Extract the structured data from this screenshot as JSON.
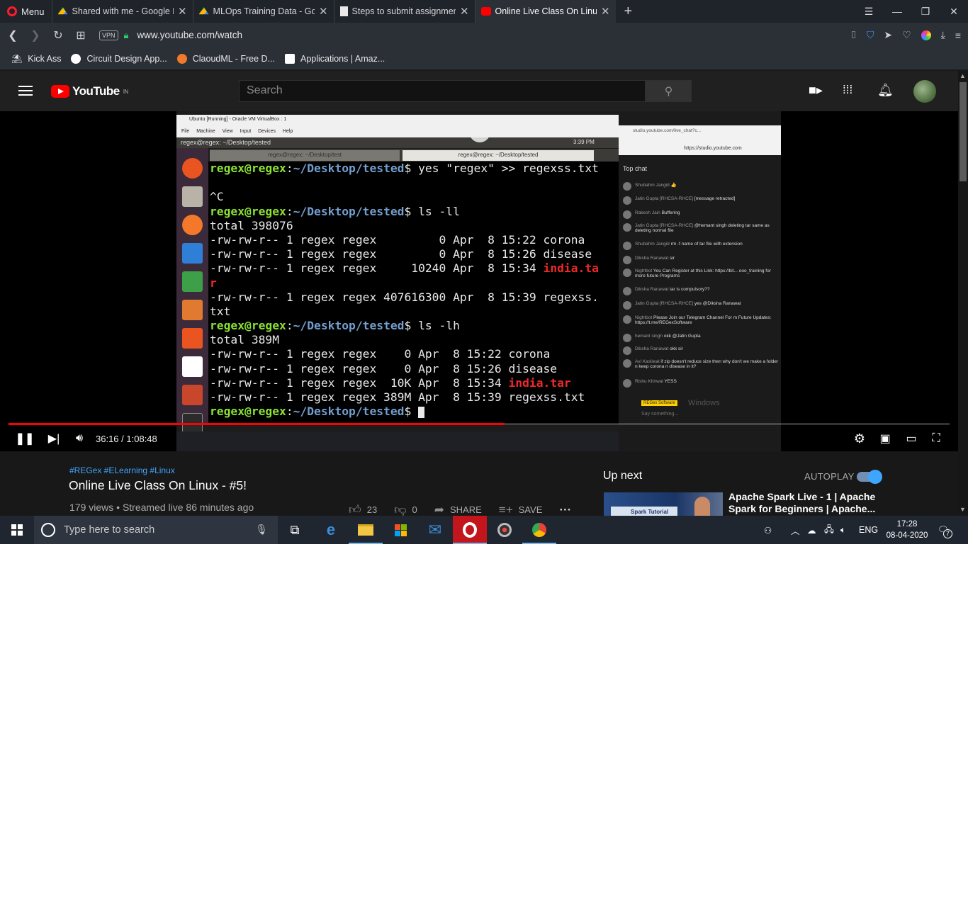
{
  "browser": {
    "menu_label": "Menu",
    "tabs": [
      {
        "title": "Shared with me - Google D",
        "favicon": "drive-icon",
        "active": false
      },
      {
        "title": "MLOps Training Data - Goo",
        "favicon": "drive-icon",
        "active": false
      },
      {
        "title": "Steps to submit assignmen",
        "favicon": "document-icon",
        "active": false
      },
      {
        "title": "Online Live Class On Linux",
        "favicon": "youtube-icon",
        "active": true
      }
    ],
    "url": "www.youtube.com/watch",
    "vpn_label": "VPN",
    "bookmarks": [
      "Kick Ass",
      "Circuit Design App...",
      "ClaoudML - Free D...",
      "Applications | Amaz..."
    ]
  },
  "youtube": {
    "logo_text": "YouTube",
    "region": "IN",
    "search_placeholder": "Search"
  },
  "video_frame": {
    "vbox_title": "Ubuntu [Running] - Oracle VM VirtualBox : 1",
    "vbox_menu": "File Machine View Input Devices Help",
    "ubuntu_window_title": "regex@regex: ~/Desktop/tested",
    "ubuntu_clock": "3:39 PM",
    "terminal_tabs": [
      "regex@regex: ~/Desktop/test",
      "regex@regex: ~/Desktop/tested"
    ],
    "terminal_lines": [
      {
        "prompt": "regex@regex",
        "path": "~/Desktop/tested",
        "cmd": " yes \"regex\" >> regexss.txt"
      },
      {
        "text": ""
      },
      {
        "text": "^C"
      },
      {
        "prompt": "regex@regex",
        "path": "~/Desktop/tested",
        "cmd": " ls -ll"
      },
      {
        "text": "total 398076"
      },
      {
        "text": "-rw-rw-r-- 1 regex regex         0 Apr  8 15:22 corona"
      },
      {
        "text": "-rw-rw-r-- 1 regex regex         0 Apr  8 15:26 disease"
      },
      {
        "text": "-rw-rw-r-- 1 regex regex     10240 Apr  8 15:34 ",
        "red": "india.ta"
      },
      {
        "text": "",
        "red": "r"
      },
      {
        "text": "-rw-rw-r-- 1 regex regex 407616300 Apr  8 15:39 regexss."
      },
      {
        "text": "txt"
      },
      {
        "prompt": "regex@regex",
        "path": "~/Desktop/tested",
        "cmd": " ls -lh"
      },
      {
        "text": "total 389M"
      },
      {
        "text": "-rw-rw-r-- 1 regex regex    0 Apr  8 15:22 corona"
      },
      {
        "text": "-rw-rw-r-- 1 regex regex    0 Apr  8 15:26 disease"
      },
      {
        "text": "-rw-rw-r-- 1 regex regex  10K Apr  8 15:34 ",
        "red": "india.tar"
      },
      {
        "text": "-rw-rw-r-- 1 regex regex 389M Apr  8 15:39 regexss.txt"
      },
      {
        "prompt": "regex@regex",
        "path": "~/Desktop/tested",
        "cmd": " ",
        "cursor": true
      }
    ],
    "chat_url": "https://studio.youtube.com",
    "chat_tab": "studio.youtube.com/live_chat?c...",
    "chat_header": "Top chat",
    "chat_messages": [
      {
        "user": "Shubahm Jangid",
        "text": "👍"
      },
      {
        "user": "Jatin Gupta [RHCSA-RHCE]",
        "text": "[message retracted]"
      },
      {
        "user": "Rakesh Jain",
        "text": "Buffering"
      },
      {
        "user": "Jatin Gupta [RHCSA-RHCE]",
        "text": "@hemant singh deleting tar same as deleting normal file"
      },
      {
        "user": "Shubahm Jangid",
        "text": "rm -f name of tar file with extension"
      },
      {
        "user": "Diksha Ranawat",
        "text": "sir"
      },
      {
        "user": "Nightbot",
        "text": "You Can Register at this Link: https://bit... ooo_training for more future Programs"
      },
      {
        "user": "Diksha Ranawat",
        "text": "tar is compulsory??"
      },
      {
        "user": "Jatin Gupta [RHCSA-RHCE]",
        "text": "yes @Diksha Ranawat"
      },
      {
        "user": "Nightbot",
        "text": "Please Join our Telegram Channel For m Future Updates: https://t.me/REGexSoftware"
      },
      {
        "user": "hemant singh",
        "text": "okk @Jatin Gupta"
      },
      {
        "user": "Diksha Ranawat",
        "text": "okk sir"
      },
      {
        "user": "Avi Kasliwal",
        "text": "if zip doesn't reduce size then why don't we make a folder n keep corona n disease in it?"
      },
      {
        "user": "Rishu Khirwal",
        "text": "YESS"
      }
    ],
    "chat_footer_badge": "REGex Software",
    "chat_footer_text": "Say something...",
    "watermark": "Windows"
  },
  "player": {
    "current_time": "36:16",
    "duration": "1:08:48",
    "progress": 0.527
  },
  "info": {
    "hashtags": "#REGex #ELearning #Linux",
    "title": "Online Live Class On Linux - #5!",
    "views": "179 views",
    "streamed": "Streamed live 86 minutes ago",
    "likes": "23",
    "dislikes": "0",
    "share_label": "SHARE",
    "save_label": "SAVE"
  },
  "sidebar": {
    "up_next_label": "Up next",
    "autoplay_label": "AUTOPLAY",
    "autoplay_on": true,
    "next_video_title": "Apache Spark Live - 1 | Apache Spark for Beginners | Apache...",
    "thumb_text": "Spark Tutorial"
  },
  "taskbar": {
    "search_placeholder": "Type here to search",
    "language": "ENG",
    "time": "17:28",
    "date": "08-04-2020",
    "notifications": "7"
  },
  "colors": {
    "youtube_red": "#ff0000",
    "link_blue": "#3ea6ff",
    "terminal_green": "#8ae234",
    "terminal_blue": "#729fcf",
    "terminal_red": "#ef2929"
  }
}
